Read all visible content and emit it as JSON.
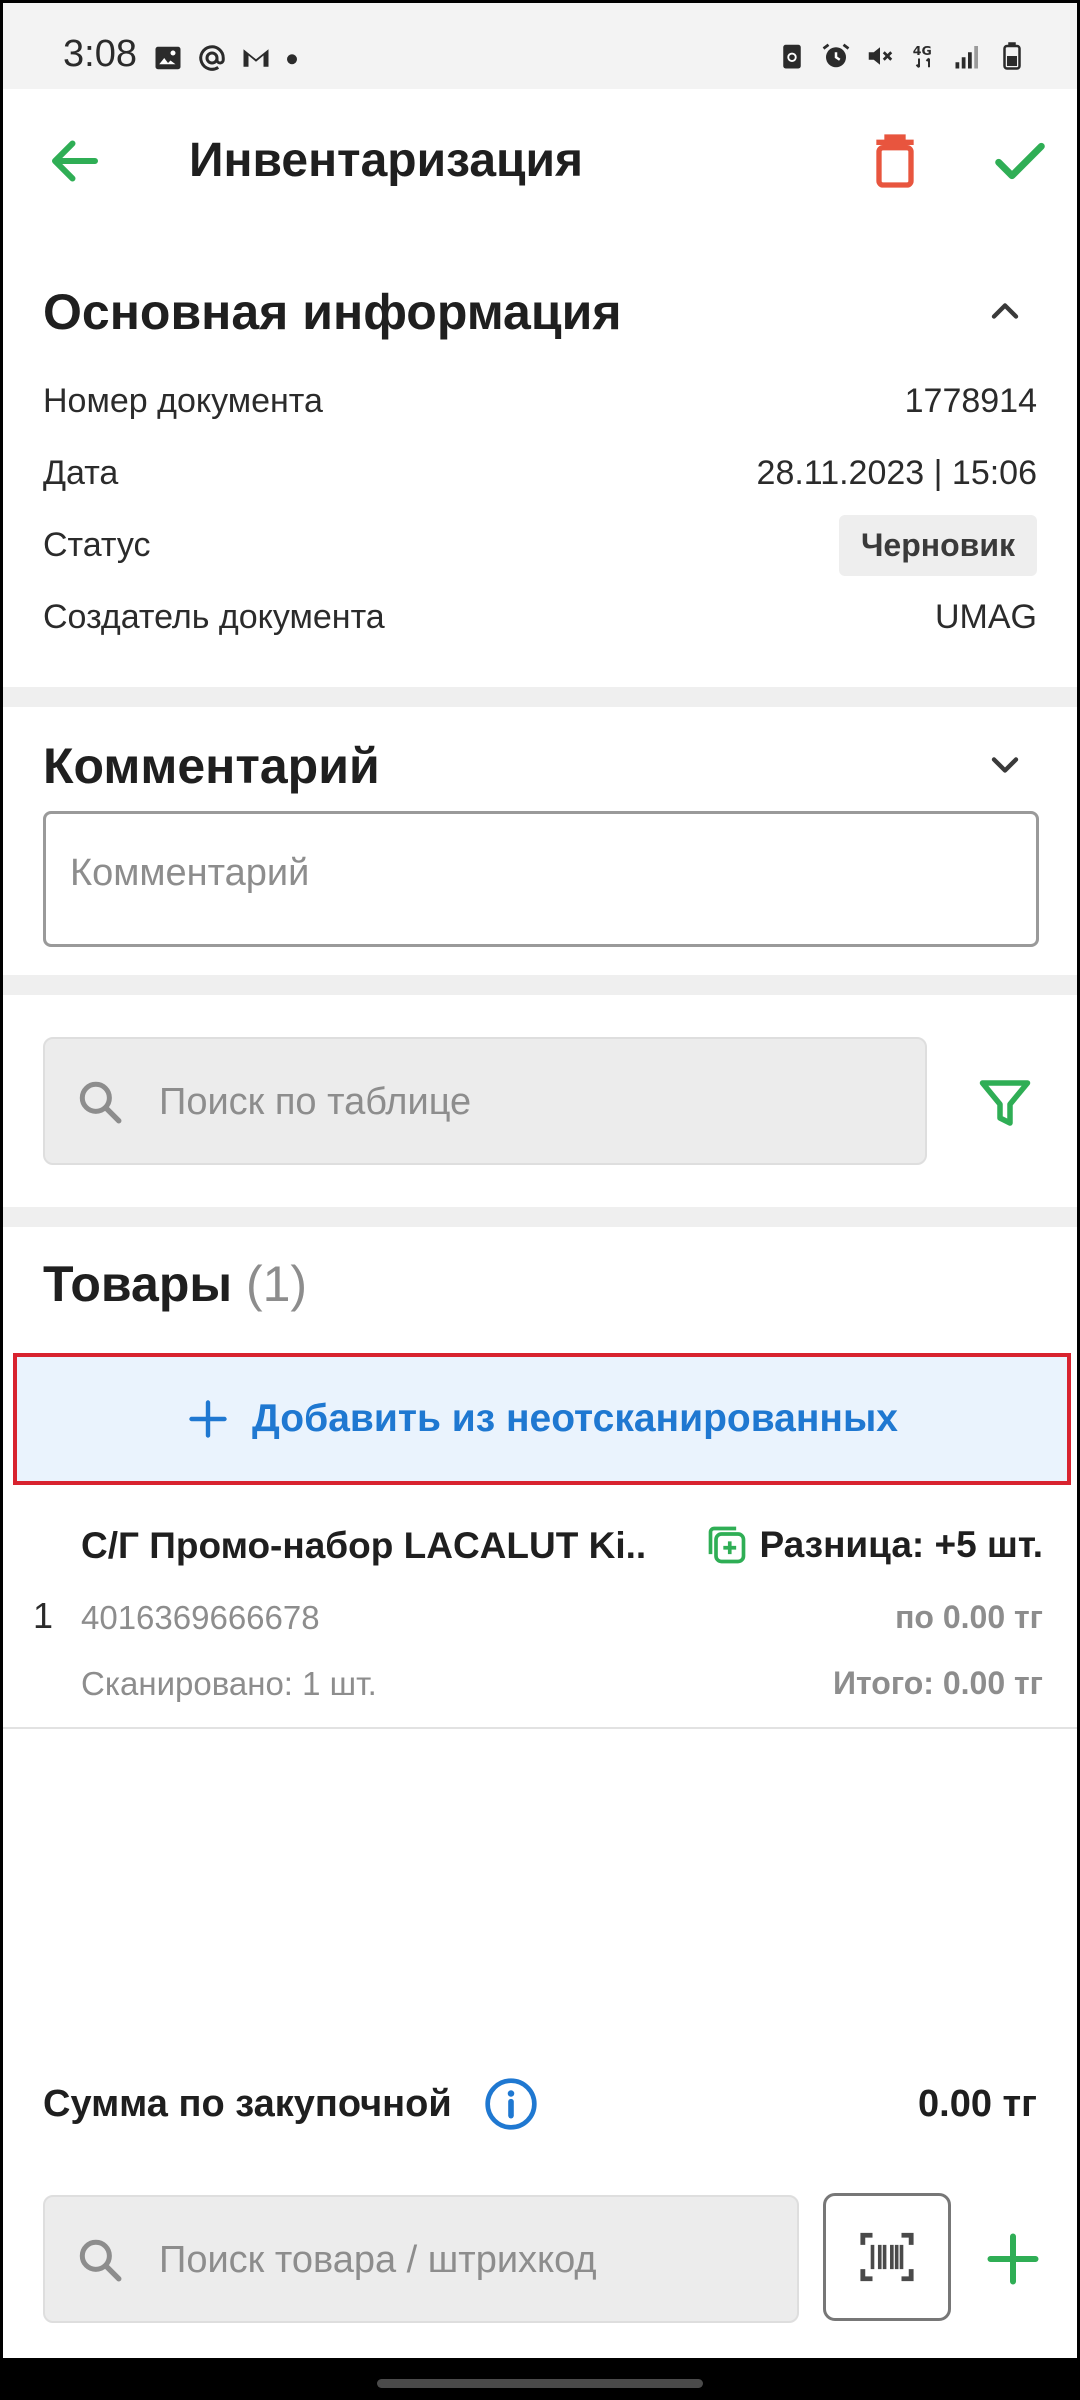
{
  "status_bar": {
    "time": "3:08",
    "left_icons": [
      "image-icon",
      "at-icon",
      "mail-icon",
      "dot-icon"
    ],
    "right_icons": [
      "battery-saver-icon",
      "alarm-icon",
      "mute-icon",
      "4g-icon",
      "signal-icon",
      "battery-icon"
    ]
  },
  "app_bar": {
    "title": "Инвентаризация",
    "back_icon": "arrow-left-icon",
    "delete_icon": "trash-icon",
    "confirm_icon": "check-icon"
  },
  "main_info": {
    "title": "Основная информация",
    "rows": [
      {
        "label": "Номер документа",
        "value": "1778914"
      },
      {
        "label": "Дата",
        "value": "28.11.2023 | 15:06"
      },
      {
        "label": "Статус",
        "value": "Черновик"
      },
      {
        "label": "Создатель документа",
        "value": "UMAG"
      }
    ]
  },
  "comment": {
    "title": "Комментарий",
    "placeholder": "Комментарий",
    "value": ""
  },
  "table_search": {
    "placeholder": "Поиск по таблице",
    "value": ""
  },
  "goods": {
    "title": "Товары",
    "count": "(1)",
    "add_unscanned_label": "Добавить из неотсканированных",
    "items": [
      {
        "index": "1",
        "name": "С/Г Промо-набор LACALUT Ki..",
        "difference": "Разница: +5 шт.",
        "barcode": "4016369666678",
        "price": "по 0.00 тг",
        "scanned": "Сканировано: 1 шт.",
        "total": "Итого: 0.00 тг"
      }
    ]
  },
  "footer": {
    "sum_label": "Сумма по закупочной",
    "sum_value": "0.00 тг",
    "product_search_placeholder": "Поиск товара / штрихкод"
  },
  "colors": {
    "accent_green": "#2fae55",
    "delete_red": "#e8553e",
    "link_blue": "#1f78d1",
    "highlight_red": "#d8232f"
  }
}
